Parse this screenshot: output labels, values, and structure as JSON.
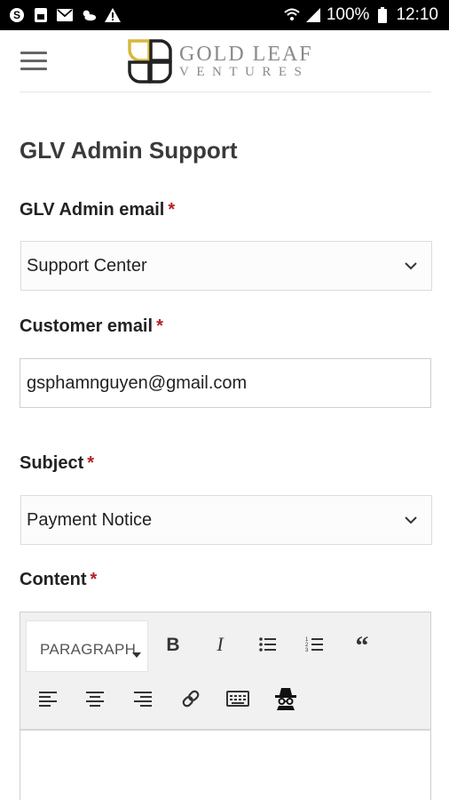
{
  "status_bar": {
    "battery_pct": "100%",
    "time": "12:10",
    "left_icons": [
      "skype-icon",
      "sim-card-icon",
      "mail-icon",
      "weather-icon",
      "warning-icon"
    ],
    "right_icons": [
      "wifi-icon",
      "signal-icon",
      "battery-icon"
    ]
  },
  "header": {
    "menu_icon": "hamburger-menu-icon",
    "logo_line1": "GOLD LEAF",
    "logo_line2": "VENTURES",
    "logo_color": "#d9b73a"
  },
  "form": {
    "title": "GLV Admin Support",
    "required_mark": "*",
    "admin_email": {
      "label": "GLV Admin email",
      "value": "Support Center"
    },
    "customer_email": {
      "label": "Customer email",
      "value": "gsphamnguyen@gmail.com"
    },
    "subject": {
      "label": "Subject",
      "value": "Payment Notice"
    },
    "content": {
      "label": "Content"
    }
  },
  "editor": {
    "format_select": "PARAGRAPH",
    "tools": [
      "bold-icon",
      "italic-icon",
      "bullet-list-icon",
      "numbered-list-icon",
      "blockquote-icon",
      "align-left-icon",
      "align-center-icon",
      "align-right-icon",
      "link-icon",
      "keyboard-icon",
      "incognito-icon"
    ]
  },
  "colors": {
    "required": "#b32020",
    "text": "#222222",
    "toolbar_bg": "#f1f1f1"
  }
}
